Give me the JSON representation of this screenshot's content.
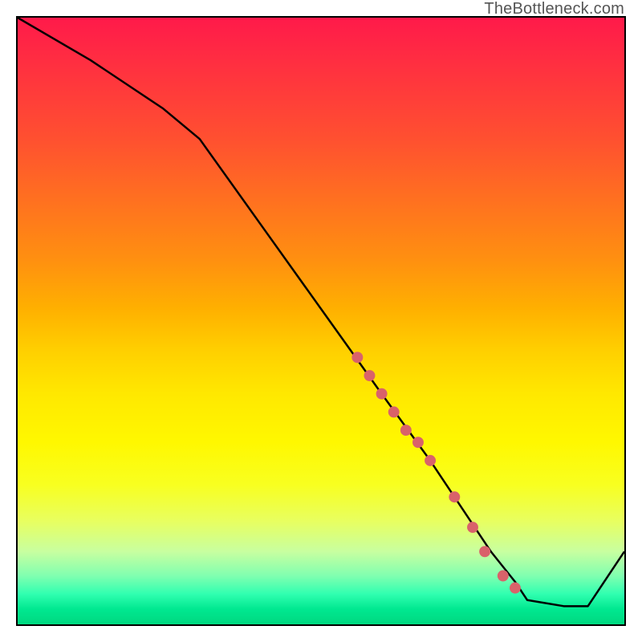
{
  "watermark": "TheBottleneck.com",
  "chart_data": {
    "type": "line",
    "title": "",
    "xlabel": "",
    "ylabel": "",
    "xlim": [
      0,
      100
    ],
    "ylim": [
      0,
      100
    ],
    "background": "rainbow-gradient-red-to-green",
    "series": [
      {
        "name": "curve",
        "type": "line",
        "color": "#000000",
        "x": [
          0,
          12,
          24,
          30,
          40,
          50,
          60,
          68,
          74,
          78,
          82,
          84,
          90,
          94,
          100
        ],
        "values": [
          100,
          93,
          85,
          80,
          66,
          52,
          38,
          27,
          18,
          12,
          7,
          4,
          3,
          3,
          12
        ]
      },
      {
        "name": "highlighted-points",
        "type": "scatter",
        "color": "#d9626a",
        "x": [
          56,
          58,
          60,
          62,
          64,
          66,
          68,
          72,
          75,
          77,
          80,
          82
        ],
        "values": [
          44,
          41,
          38,
          35,
          32,
          30,
          27,
          21,
          16,
          12,
          8,
          6
        ]
      }
    ]
  }
}
